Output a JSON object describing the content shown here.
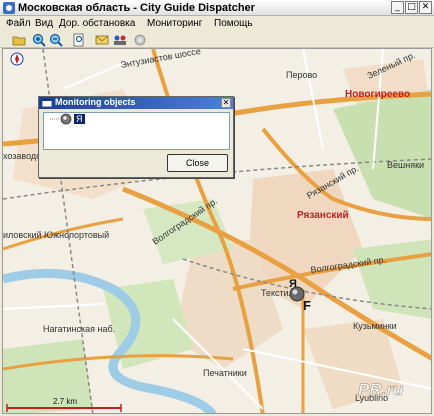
{
  "window": {
    "title": "Московская область - City Guide Dispatcher",
    "controls": [
      "_",
      "□",
      "✕"
    ]
  },
  "menu": [
    "Файл",
    "Вид",
    "Дор. обстановка",
    "Мониторинг",
    "Помощь"
  ],
  "toolbar": {
    "icons": [
      "open-folder-icon",
      "zoom-in-icon",
      "zoom-out-icon",
      "find-icon",
      "mail-icon",
      "objects-icon",
      "settings-icon"
    ]
  },
  "map": {
    "labels": {
      "entuziastov": "Энтузиастов шоссе",
      "perovo": "Перово",
      "zeleny": "Зеленый пр.",
      "novogireevo": "Новогиреево",
      "veshnyaki": "Вешняки",
      "ryazansky_pr": "Рязанский пр.",
      "ryazansky": "Рязанский",
      "volgogradsky1": "Волгоградский пр.",
      "volgogradsky2": "Волгоградский пр.",
      "tekstil": "Текстиль",
      "yuzhnoportovy": "иловский Южнопортовый",
      "zavod": "хозаводская",
      "nagatinskaya": "Нагатинская наб.",
      "kuzminki": "Кузьминки",
      "pechatniki": "Печатники",
      "lyublino": "Lyublino",
      "marker_letter_top": "Я",
      "marker_letter_bottom": "F",
      "watermark": "PR.ru"
    },
    "scale": "2.7 km",
    "compass": "N"
  },
  "dialog": {
    "title": "Monitoring objects",
    "item_label": "Я",
    "close_label": "Close",
    "close_icon": "✕"
  }
}
